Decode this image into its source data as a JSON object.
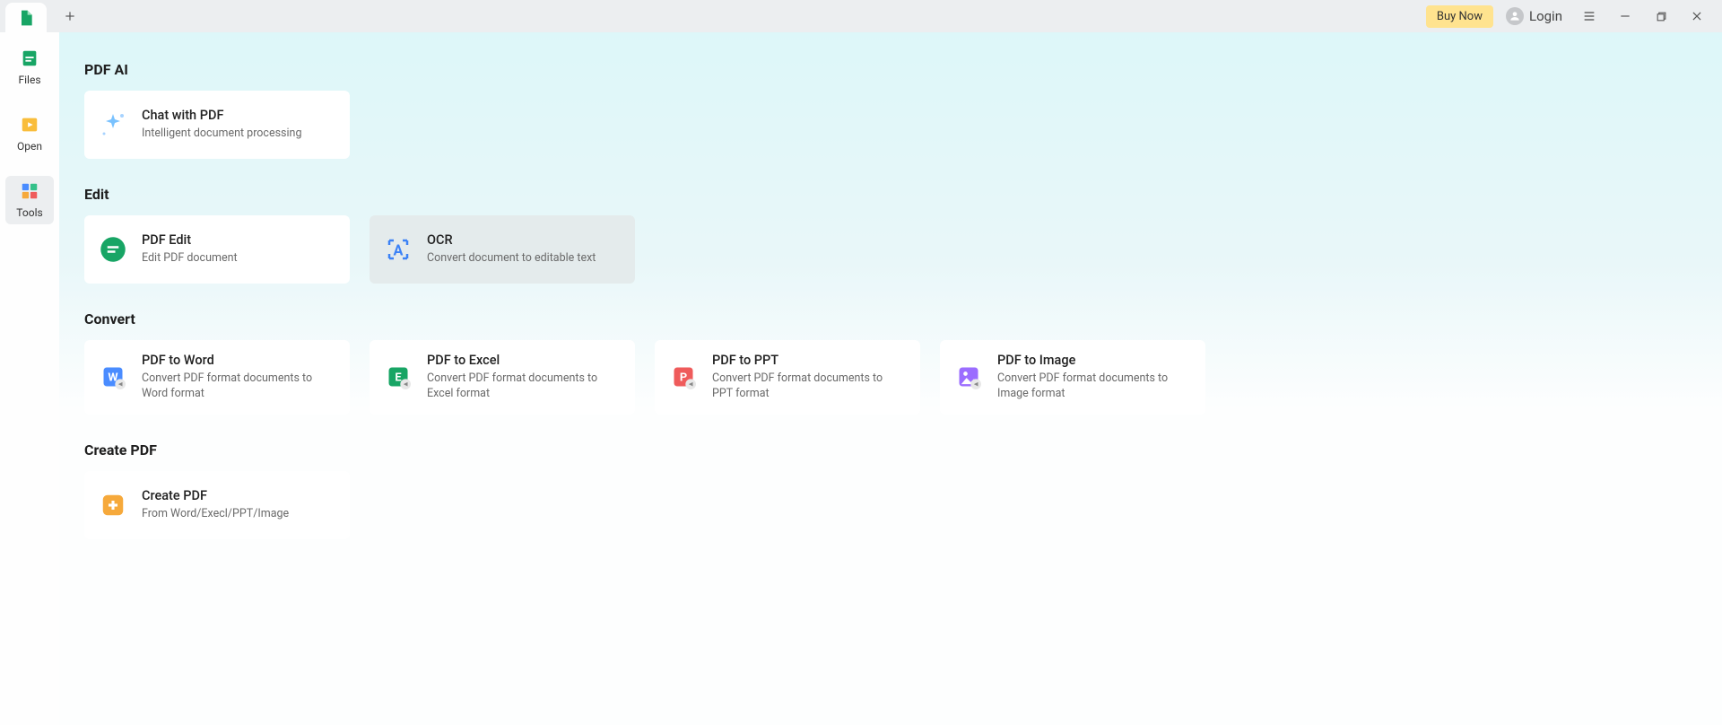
{
  "titlebar": {
    "buy_now": "Buy Now",
    "login": "Login"
  },
  "sidebar": {
    "items": [
      {
        "label": "Files"
      },
      {
        "label": "Open"
      },
      {
        "label": "Tools"
      }
    ]
  },
  "sections": {
    "pdf_ai": {
      "title": "PDF AI",
      "cards": [
        {
          "title": "Chat with PDF",
          "desc": "Intelligent document processing"
        }
      ]
    },
    "edit": {
      "title": "Edit",
      "cards": [
        {
          "title": "PDF Edit",
          "desc": "Edit PDF document"
        },
        {
          "title": "OCR",
          "desc": "Convert document to editable text"
        }
      ]
    },
    "convert": {
      "title": "Convert",
      "cards": [
        {
          "title": "PDF to Word",
          "desc": "Convert PDF format documents to Word format"
        },
        {
          "title": "PDF to Excel",
          "desc": "Convert PDF format documents to Excel format"
        },
        {
          "title": "PDF to PPT",
          "desc": "Convert PDF format documents to PPT format"
        },
        {
          "title": "PDF to Image",
          "desc": "Convert PDF format documents to Image format"
        }
      ]
    },
    "create": {
      "title": "Create PDF",
      "cards": [
        {
          "title": "Create PDF",
          "desc": "From Word/Execl/PPT/Image"
        }
      ]
    }
  }
}
